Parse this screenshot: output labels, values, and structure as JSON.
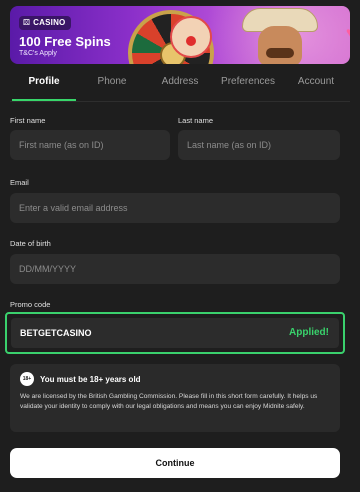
{
  "banner": {
    "badge": "CASINO",
    "title": "100 Free Spins",
    "subtitle": "T&C's Apply"
  },
  "tabs": [
    {
      "label": "Profile"
    },
    {
      "label": "Phone"
    },
    {
      "label": "Address"
    },
    {
      "label": "Preferences"
    },
    {
      "label": "Account"
    }
  ],
  "form": {
    "first_name": {
      "label": "First name",
      "placeholder": "First name (as on ID)"
    },
    "last_name": {
      "label": "Last name",
      "placeholder": "Last name (as on ID)"
    },
    "email": {
      "label": "Email",
      "placeholder": "Enter a valid email address"
    },
    "dob": {
      "label": "Date of birth",
      "placeholder": "DD/MM/YYYY"
    },
    "promo": {
      "label": "Promo code",
      "value": "BETGETCASINO",
      "status": "Applied!"
    }
  },
  "notice": {
    "badge": "18+",
    "title": "You must be 18+ years old",
    "body": "We are licensed by the British Gambling Commission. Please fill in this short form carefully. It helps us validate your identity to comply with our legal obligations and means you can enjoy Midnite safely."
  },
  "continue_label": "Continue",
  "colors": {
    "accent": "#38d66a",
    "background": "#1e1e1e",
    "field": "#2c2c2c"
  }
}
